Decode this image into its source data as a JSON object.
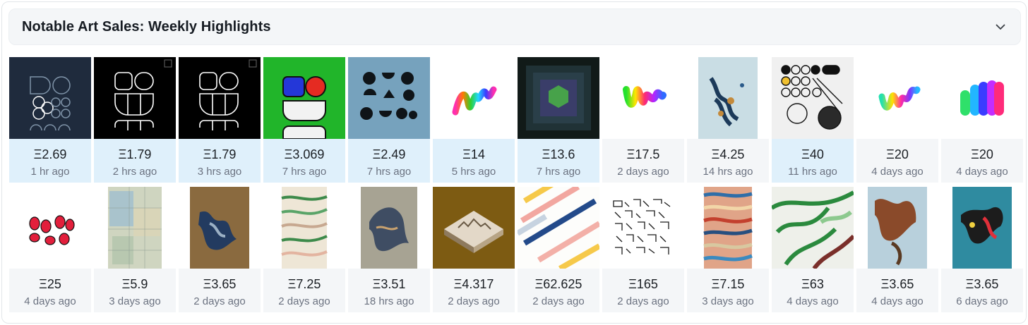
{
  "title": "Notable Art Sales: Weekly Highlights",
  "icons": {
    "toggle": "chevron-down-icon"
  },
  "colors": {
    "highlight_bg": "#dff0fb",
    "plain_bg": "#f4f6f8",
    "header_bg": "#f4f6f8"
  },
  "rows": [
    [
      {
        "price": "Ξ2.69",
        "ago": "1 hr ago",
        "highlight": true
      },
      {
        "price": "Ξ1.79",
        "ago": "2 hrs ago",
        "highlight": true
      },
      {
        "price": "Ξ1.79",
        "ago": "3 hrs ago",
        "highlight": true
      },
      {
        "price": "Ξ3.069",
        "ago": "7 hrs ago",
        "highlight": true
      },
      {
        "price": "Ξ2.49",
        "ago": "7 hrs ago",
        "highlight": true
      },
      {
        "price": "Ξ14",
        "ago": "5 hrs ago",
        "highlight": true
      },
      {
        "price": "Ξ13.6",
        "ago": "7 hrs ago",
        "highlight": true
      },
      {
        "price": "Ξ17.5",
        "ago": "2 days ago",
        "highlight": false
      },
      {
        "price": "Ξ4.25",
        "ago": "14 hrs ago",
        "highlight": false
      },
      {
        "price": "Ξ40",
        "ago": "11 hrs ago",
        "highlight": true
      },
      {
        "price": "Ξ20",
        "ago": "4 days ago",
        "highlight": false
      },
      {
        "price": "Ξ20",
        "ago": "4 days ago",
        "highlight": false
      }
    ],
    [
      {
        "price": "Ξ25",
        "ago": "4 days ago",
        "highlight": false
      },
      {
        "price": "Ξ5.9",
        "ago": "3 days ago",
        "highlight": false
      },
      {
        "price": "Ξ3.65",
        "ago": "2 days ago",
        "highlight": false
      },
      {
        "price": "Ξ7.25",
        "ago": "2 days ago",
        "highlight": false
      },
      {
        "price": "Ξ3.51",
        "ago": "18 hrs ago",
        "highlight": false
      },
      {
        "price": "Ξ4.317",
        "ago": "2 days ago",
        "highlight": false
      },
      {
        "price": "Ξ62.625",
        "ago": "2 days ago",
        "highlight": false
      },
      {
        "price": "Ξ165",
        "ago": "2 days ago",
        "highlight": false
      },
      {
        "price": "Ξ7.15",
        "ago": "3 days ago",
        "highlight": false
      },
      {
        "price": "Ξ63",
        "ago": "4 days ago",
        "highlight": false
      },
      {
        "price": "Ξ3.65",
        "ago": "4 days ago",
        "highlight": false
      },
      {
        "price": "Ξ3.65",
        "ago": "6 days ago",
        "highlight": false
      }
    ]
  ]
}
